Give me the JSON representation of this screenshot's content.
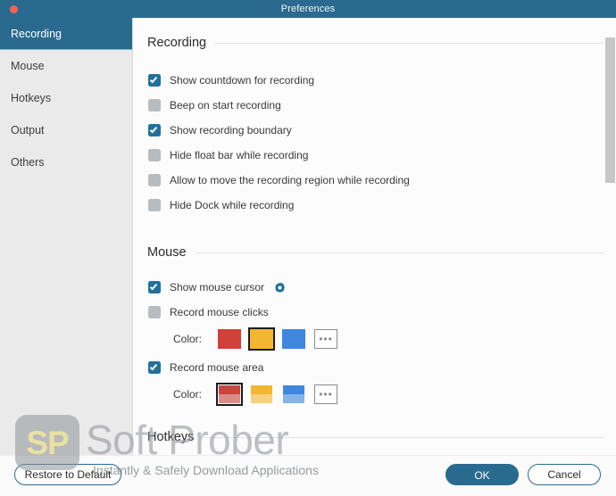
{
  "window": {
    "title": "Preferences",
    "close_icon": "close-dot-icon"
  },
  "colors": {
    "accent": "#2B6A8F",
    "accent_checkbox": "#22709B",
    "close_button": "#F26452",
    "sidebar_bg": "#EAEAEA",
    "content_bg": "#FCFCFC",
    "checkbox_off": "#B8BCBE"
  },
  "sidebar": {
    "items": [
      {
        "label": "Recording",
        "active": true
      },
      {
        "label": "Mouse",
        "active": false
      },
      {
        "label": "Hotkeys",
        "active": false
      },
      {
        "label": "Output",
        "active": false
      },
      {
        "label": "Others",
        "active": false
      }
    ]
  },
  "sections": {
    "recording": {
      "title": "Recording",
      "options": [
        {
          "label": "Show countdown for recording",
          "checked": true
        },
        {
          "label": "Beep on start recording",
          "checked": false
        },
        {
          "label": "Show recording boundary",
          "checked": true
        },
        {
          "label": "Hide float bar while recording",
          "checked": false
        },
        {
          "label": "Allow to move the recording region while recording",
          "checked": false
        },
        {
          "label": "Hide Dock while recording",
          "checked": false
        }
      ]
    },
    "mouse": {
      "title": "Mouse",
      "show_cursor": {
        "label": "Show mouse cursor",
        "checked": true,
        "settings_icon": "gear-icon"
      },
      "record_clicks": {
        "label": "Record mouse clicks",
        "checked": false
      },
      "record_clicks_color": {
        "label": "Color:",
        "swatches": [
          {
            "name": "red",
            "color": "#D0413A",
            "selected": false
          },
          {
            "name": "yellow",
            "color": "#F2B632",
            "selected": true
          },
          {
            "name": "blue",
            "color": "#3F86DE",
            "selected": false
          }
        ],
        "more_label": "•••"
      },
      "record_area": {
        "label": "Record mouse area",
        "checked": true
      },
      "record_area_color": {
        "label": "Color:",
        "swatches": [
          {
            "name": "red",
            "color": "#C9463F",
            "selected": true
          },
          {
            "name": "yellow",
            "color": "#F2B632",
            "selected": false
          },
          {
            "name": "blue",
            "color": "#3F86DE",
            "selected": false
          }
        ],
        "more_label": "•••"
      }
    },
    "hotkeys": {
      "title": "Hotkeys"
    }
  },
  "footer": {
    "restore_label": "Restore to Default",
    "ok_label": "OK",
    "cancel_label": "Cancel"
  },
  "watermark": {
    "logo_text": "SP",
    "title": "Soft Prober",
    "subtitle": "Instantly & Safely Download Applications"
  }
}
